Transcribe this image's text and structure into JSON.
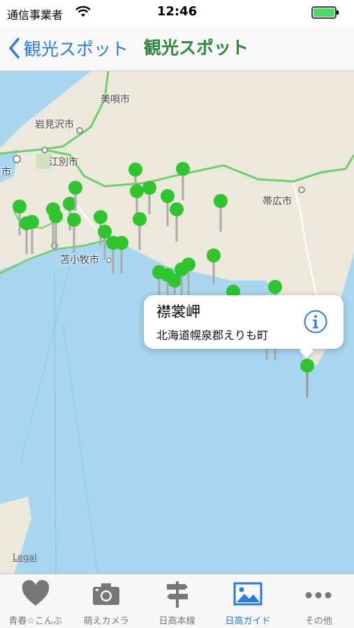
{
  "status_bar": {
    "carrier": "通信事業者",
    "time": "12:46"
  },
  "nav": {
    "back_label": "観光スポット",
    "title": "観光スポット"
  },
  "map": {
    "places": [
      "美唄市",
      "岩見沢市",
      "江別市",
      "市",
      "帯広市",
      "苫小牧市"
    ],
    "legal": "Legal",
    "pin_color": "#2ec52e"
  },
  "callout": {
    "title": "襟裳岬",
    "subtitle": "北海道幌泉郡えりも町",
    "icon": "info-icon"
  },
  "tabs": [
    {
      "label": "青春☆こんぶ",
      "icon": "heart-icon"
    },
    {
      "label": "萌えカメラ",
      "icon": "camera-icon"
    },
    {
      "label": "日高本線",
      "icon": "signpost-icon"
    },
    {
      "label": "日高ガイド",
      "icon": "picture-icon"
    },
    {
      "label": "その他",
      "icon": "more-icon"
    }
  ],
  "active_tab": "日高ガイド",
  "colors": {
    "accent": "#2a7ae2",
    "title_green": "#2e8b3c",
    "sea": "#a8d6f0",
    "land": "#ede8dc",
    "road": "#6ccf6c"
  }
}
